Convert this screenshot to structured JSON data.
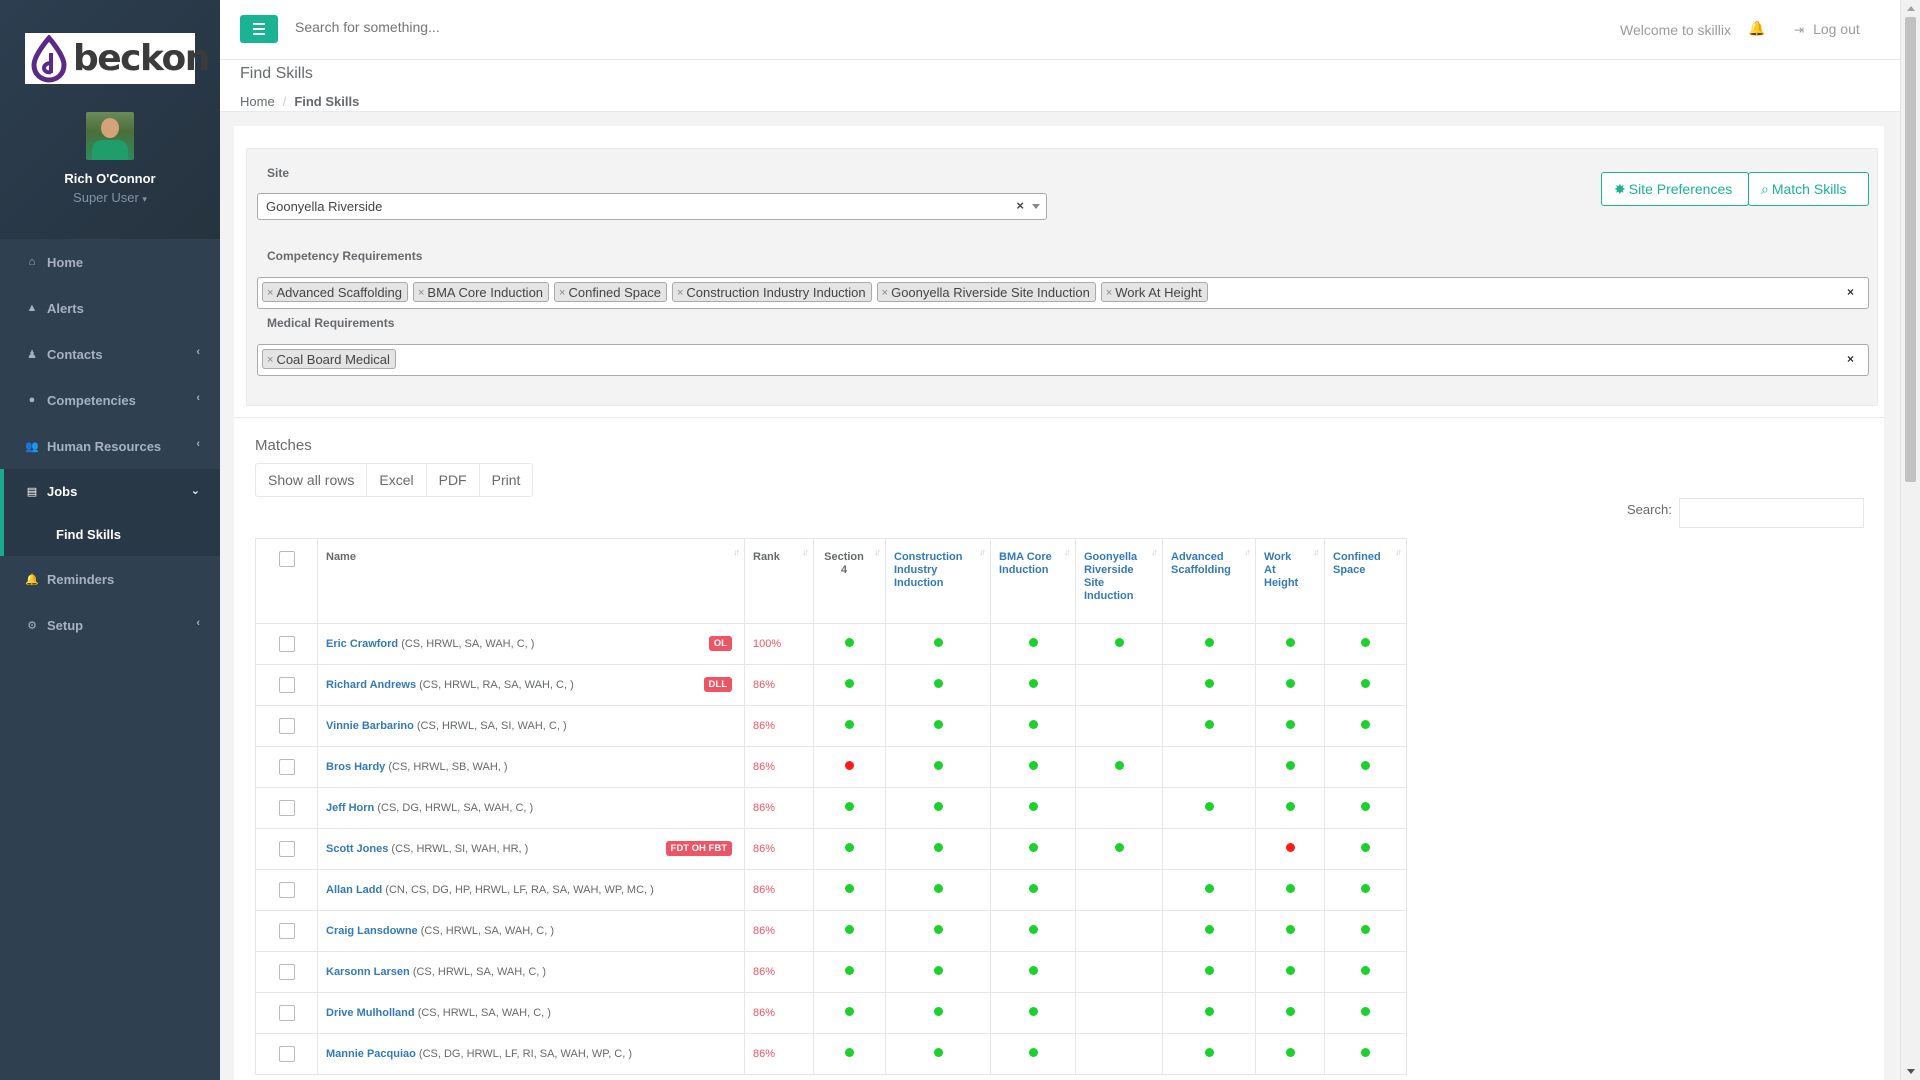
{
  "brand": {
    "logo_text": "beckon"
  },
  "user": {
    "name": "Rich O'Connor",
    "role": "Super User"
  },
  "sidebar": {
    "items": [
      {
        "label": "Home",
        "icon": "home-icon"
      },
      {
        "label": "Alerts",
        "icon": "alert-icon"
      },
      {
        "label": "Contacts",
        "icon": "contacts-icon"
      },
      {
        "label": "Competencies",
        "icon": "circle-icon"
      },
      {
        "label": "Human Resources",
        "icon": "users-icon"
      },
      {
        "label": "Jobs",
        "icon": "map-icon"
      },
      {
        "label": "Reminders",
        "icon": "bell-icon"
      },
      {
        "label": "Setup",
        "icon": "gear-icon"
      }
    ],
    "sub_item": "Find Skills"
  },
  "topbar": {
    "search_placeholder": "Search for something...",
    "welcome": "Welcome to skillix",
    "logout": "Log out"
  },
  "heading": {
    "title": "Find Skills",
    "breadcrumb_home": "Home",
    "breadcrumb_current": "Find Skills"
  },
  "filters": {
    "site_label": "Site",
    "site_value": "Goonyella Riverside",
    "competency_label": "Competency Requirements",
    "competencies": [
      "Advanced Scaffolding",
      "BMA Core Induction",
      "Confined Space",
      "Construction Industry Induction",
      "Goonyella Riverside Site Induction",
      "Work At Height"
    ],
    "medical_label": "Medical Requirements",
    "medical": [
      "Coal Board Medical"
    ],
    "site_prefs_button": "Site Preferences",
    "match_button": "Match Skills"
  },
  "matches": {
    "title": "Matches",
    "buttons": [
      "Show all rows",
      "Excel",
      "PDF",
      "Print"
    ],
    "search_label": "Search:",
    "columns": [
      "Name",
      "Rank",
      "Section 4",
      "Construction Industry Induction",
      "BMA Core Induction",
      "Goonyella Riverside Site Induction",
      "Advanced Scaffolding",
      "Work At Height",
      "Confined Space"
    ],
    "rows": [
      {
        "name": "Eric Crawford",
        "codes": "(CS, HRWL, SA, WAH, C, )",
        "badge": "OL",
        "rank": "100%",
        "status": [
          "g",
          "g",
          "g",
          "g",
          "g",
          "g",
          "g"
        ]
      },
      {
        "name": "Richard Andrews",
        "codes": "(CS, HRWL, RA, SA, WAH, C, )",
        "badge": "DLL",
        "rank": "86%",
        "status": [
          "g",
          "g",
          "g",
          "",
          "g",
          "g",
          "g"
        ]
      },
      {
        "name": "Vinnie Barbarino",
        "codes": "(CS, HRWL, SA, SI, WAH, C, )",
        "badge": "",
        "rank": "86%",
        "status": [
          "g",
          "g",
          "g",
          "",
          "g",
          "g",
          "g"
        ]
      },
      {
        "name": "Bros Hardy",
        "codes": "(CS, HRWL, SB, WAH, )",
        "badge": "",
        "rank": "86%",
        "status": [
          "r",
          "g",
          "g",
          "g",
          "",
          "g",
          "g"
        ]
      },
      {
        "name": "Jeff Horn",
        "codes": "(CS, DG, HRWL, SA, WAH, C, )",
        "badge": "",
        "rank": "86%",
        "status": [
          "g",
          "g",
          "g",
          "",
          "g",
          "g",
          "g"
        ]
      },
      {
        "name": "Scott Jones",
        "codes": "(CS, HRWL, SI, WAH, HR, )",
        "badge": "FDT OH FBT",
        "rank": "86%",
        "status": [
          "g",
          "g",
          "g",
          "g",
          "",
          "r",
          "g"
        ]
      },
      {
        "name": "Allan Ladd",
        "codes": "(CN, CS, DG, HP, HRWL, LF, RA, SA, WAH, WP, MC, )",
        "badge": "",
        "rank": "86%",
        "status": [
          "g",
          "g",
          "g",
          "",
          "g",
          "g",
          "g"
        ]
      },
      {
        "name": "Craig Lansdowne",
        "codes": "(CS, HRWL, SA, WAH, C, )",
        "badge": "",
        "rank": "86%",
        "status": [
          "g",
          "g",
          "g",
          "",
          "g",
          "g",
          "g"
        ]
      },
      {
        "name": "Karsonn Larsen",
        "codes": "(CS, HRWL, SA, WAH, C, )",
        "badge": "",
        "rank": "86%",
        "status": [
          "g",
          "g",
          "g",
          "",
          "g",
          "g",
          "g"
        ]
      },
      {
        "name": "Drive Mulholland",
        "codes": "(CS, HRWL, SA, WAH, C, )",
        "badge": "",
        "rank": "86%",
        "status": [
          "g",
          "g",
          "g",
          "",
          "g",
          "g",
          "g"
        ]
      },
      {
        "name": "Mannie Pacquiao",
        "codes": "(CS, DG, HRWL, LF, RI, SA, WAH, WP, C, )",
        "badge": "",
        "rank": "86%",
        "status": [
          "g",
          "g",
          "g",
          "",
          "g",
          "g",
          "g"
        ]
      }
    ]
  },
  "colors": {
    "accent": "#1ab394",
    "sidebar": "#2f4050",
    "link": "#337ab7",
    "danger": "#ed5565",
    "ok_dot": "#1bd12b",
    "bad_dot": "#ff1a1a"
  }
}
